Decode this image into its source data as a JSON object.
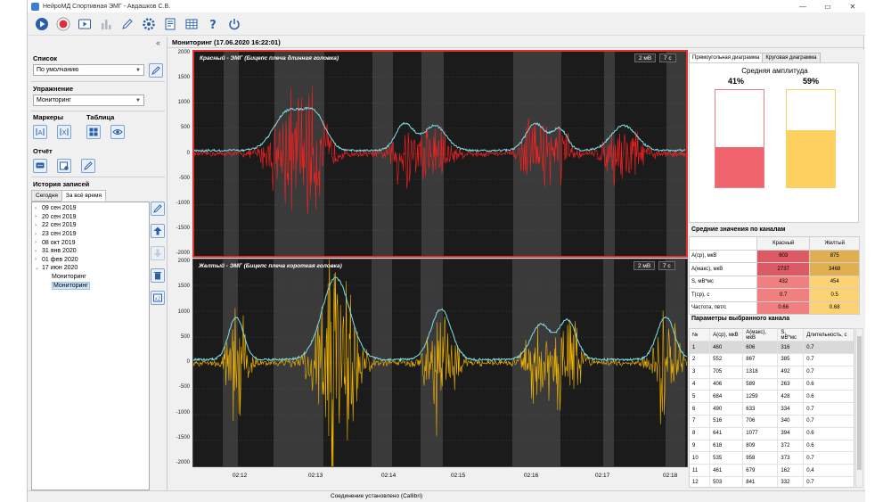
{
  "window": {
    "title": "НейроМД Спортивная ЭМГ  - Авдашков С.В.",
    "minimize": "—",
    "maximize": "▭",
    "close": "✕"
  },
  "toolbar": [
    "play-icon",
    "record-icon",
    "video-icon",
    "bar-chart-icon",
    "pencil-icon",
    "gear-icon",
    "report-icon",
    "table-icon",
    "help-icon",
    "power-icon"
  ],
  "left": {
    "collapse": "«",
    "list_label": "Список",
    "list_value": "По умолчанию",
    "exercise_label": "Упражнение",
    "exercise_value": "Мониторинг",
    "markers_label": "Маркеры",
    "table_label": "Таблица",
    "report_label": "Отчёт",
    "history_label": "История записей",
    "tabs": [
      "Сегодня",
      "За всё время"
    ],
    "tree": [
      {
        "label": "09 сен 2019",
        "expanded": false
      },
      {
        "label": "20 сен 2019",
        "expanded": false
      },
      {
        "label": "22 сен 2019",
        "expanded": false
      },
      {
        "label": "23 сен 2019",
        "expanded": false
      },
      {
        "label": "08 окт 2019",
        "expanded": false
      },
      {
        "label": "31 янв 2020",
        "expanded": false
      },
      {
        "label": "01 фев 2020",
        "expanded": false
      },
      {
        "label": "17 июн 2020",
        "expanded": true
      }
    ],
    "children": [
      "Мониторинг",
      "Мониторинг"
    ]
  },
  "monitor": {
    "title": "Мониторинг (17.06.2020 16:22:01)",
    "plot1": {
      "label": "Красный - ЭМГ (Бицепс плеча длинная головка)",
      "scale": "2 мВ",
      "time": "7 с"
    },
    "plot2": {
      "label": "Желтый - ЭМГ (Бицепс плеча короткая головка)",
      "scale": "2 мВ",
      "time": "7 с"
    },
    "yticks": [
      "2000",
      "1500",
      "1000",
      "500",
      "0",
      "-500",
      "-1000",
      "-1500",
      "-2000"
    ],
    "xticks": [
      "02:12",
      "02:13",
      "02:14",
      "02:15",
      "02:16",
      "02:17",
      "02:18"
    ]
  },
  "status": "Соединение установлено (Callibri)",
  "right": {
    "tabs": [
      "Прямоугольная диаграмма",
      "Круговая диаграмма"
    ],
    "chart_title": "Средняя амплитуда",
    "red_pct": "41%",
    "yellow_pct": "59%",
    "red_level": 0.41,
    "yellow_level": 0.59,
    "avg_title": "Средние значения по каналам",
    "avg_cols": [
      "Красный",
      "Желтый"
    ],
    "avg_rows": [
      {
        "name": "A(ср), мкВ",
        "red": "603",
        "yellow": "875"
      },
      {
        "name": "A(макс), мкВ",
        "red": "2737",
        "yellow": "3468"
      },
      {
        "name": "S, мВ*мс",
        "red": "432",
        "yellow": "454"
      },
      {
        "name": "T(ср), с",
        "red": "0.7",
        "yellow": "0.5"
      },
      {
        "name": "Частота, пвт/с",
        "red": "0.66",
        "yellow": "0.68"
      }
    ],
    "params_title": "Параметры выбранного канала",
    "params_cols": [
      "№",
      "A(ср), мкВ",
      "A(макс), мкВ",
      "S, мВ*мс",
      "Длительность, с"
    ],
    "params_rows": [
      [
        "1",
        "460",
        "606",
        "316",
        "0.7"
      ],
      [
        "2",
        "552",
        "867",
        "385",
        "0.7"
      ],
      [
        "3",
        "705",
        "1318",
        "492",
        "0.7"
      ],
      [
        "4",
        "406",
        "589",
        "263",
        "0.6"
      ],
      [
        "5",
        "684",
        "1259",
        "428",
        "0.6"
      ],
      [
        "6",
        "490",
        "633",
        "334",
        "0.7"
      ],
      [
        "7",
        "516",
        "706",
        "340",
        "0.7"
      ],
      [
        "8",
        "641",
        "1077",
        "394",
        "0.6"
      ],
      [
        "9",
        "618",
        "809",
        "372",
        "0.6"
      ],
      [
        "10",
        "535",
        "958",
        "373",
        "0.7"
      ],
      [
        "11",
        "461",
        "679",
        "162",
        "0.4"
      ],
      [
        "12",
        "503",
        "841",
        "332",
        "0.7"
      ]
    ]
  },
  "colors": {
    "red_signal": "#ff2020",
    "yellow_signal": "#f5b800",
    "envelope": "#7fe0e8",
    "red_bar": "#f0646e",
    "yellow_bar": "#fdd060",
    "cell_red": "#f08080",
    "cell_yellow": "#fdd273"
  }
}
